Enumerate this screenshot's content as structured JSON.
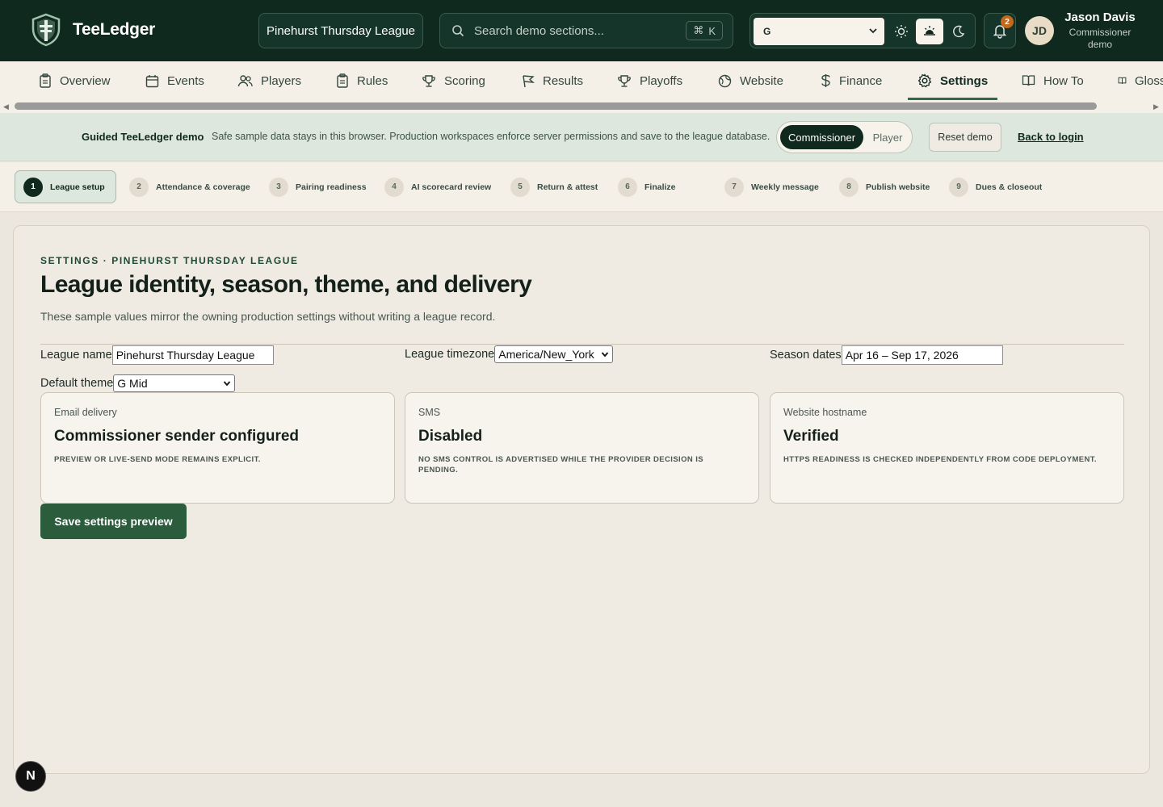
{
  "header": {
    "brand": "TeeLedger",
    "league_button": "Pinehurst Thursday League",
    "search_placeholder": "Search demo sections...",
    "search_shortcut_symbol": "⌘",
    "search_shortcut_key": "K",
    "theme_select_value": "G",
    "notifications_count": "2",
    "user": {
      "initials": "JD",
      "name": "Jason Davis",
      "role": "Commissioner demo"
    }
  },
  "nav": {
    "tabs": [
      {
        "label": "Overview",
        "icon": "clipboard-icon"
      },
      {
        "label": "Events",
        "icon": "calendar-icon"
      },
      {
        "label": "Players",
        "icon": "users-icon"
      },
      {
        "label": "Rules",
        "icon": "clipboard-icon"
      },
      {
        "label": "Scoring",
        "icon": "trophy-icon"
      },
      {
        "label": "Results",
        "icon": "flag-icon"
      },
      {
        "label": "Playoffs",
        "icon": "trophy-icon"
      },
      {
        "label": "Website",
        "icon": "globe-icon"
      },
      {
        "label": "Finance",
        "icon": "dollar-icon"
      },
      {
        "label": "Settings",
        "icon": "gear-icon",
        "active": true
      },
      {
        "label": "How To",
        "icon": "book-icon"
      },
      {
        "label": "Gloss",
        "icon": "book-icon"
      }
    ]
  },
  "banner": {
    "title": "Guided TeeLedger demo",
    "text": "Safe sample data stays in this browser. Production workspaces enforce server permissions and save to the league database.",
    "role_active": "Commissioner",
    "role_inactive": "Player",
    "reset": "Reset demo",
    "back": "Back to login"
  },
  "steps": [
    {
      "num": "1",
      "label": "League setup",
      "active": true
    },
    {
      "num": "2",
      "label": "Attendance & coverage"
    },
    {
      "num": "3",
      "label": "Pairing readiness"
    },
    {
      "num": "4",
      "label": "AI scorecard review"
    },
    {
      "num": "5",
      "label": "Return & attest"
    },
    {
      "num": "6",
      "label": "Finalize"
    },
    {
      "num": "7",
      "label": "Weekly message"
    },
    {
      "num": "8",
      "label": "Publish website"
    },
    {
      "num": "9",
      "label": "Dues & closeout"
    }
  ],
  "settings": {
    "eyebrow": "SETTINGS · PINEHURST THURSDAY LEAGUE",
    "title": "League identity, season, theme, and delivery",
    "subtitle": "These sample values mirror the owning production settings without writing a league record.",
    "fields": {
      "league_name_label": "League name",
      "league_name_value": "Pinehurst Thursday League",
      "timezone_label": "League timezone",
      "timezone_value": "America/New_York",
      "season_label": "Season dates",
      "season_value": "Apr 16 – Sep 17, 2026",
      "theme_label": "Default theme",
      "theme_value": "G Mid"
    },
    "tiles": [
      {
        "label": "Email delivery",
        "value": "Commissioner sender configured",
        "note": "Preview or live-send mode remains explicit."
      },
      {
        "label": "SMS",
        "value": "Disabled",
        "note": "No SMS control is advertised while the provider decision is pending."
      },
      {
        "label": "Website hostname",
        "value": "Verified",
        "note": "HTTPS readiness is checked independently from code deployment."
      }
    ],
    "save_button": "Save settings preview"
  },
  "dev_badge": "N"
}
